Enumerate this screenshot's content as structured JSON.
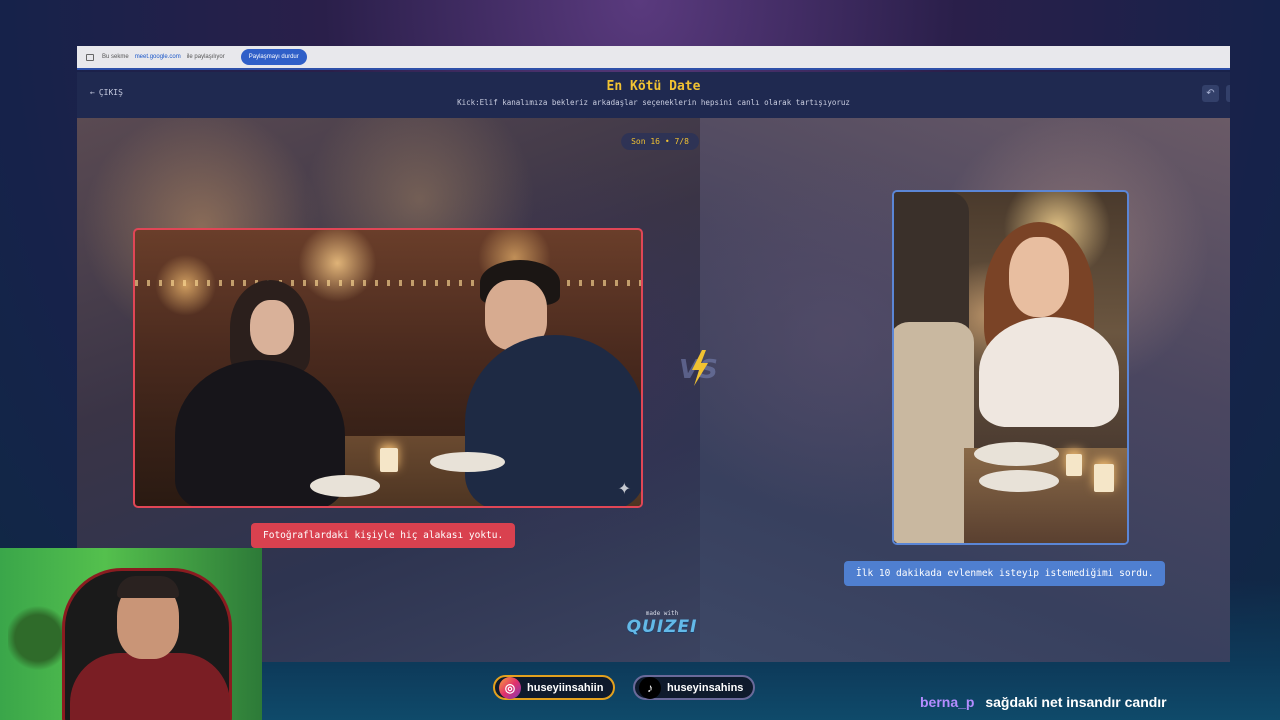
{
  "share_bar": {
    "sharing_text": "Bu sekme",
    "url": "meet.google.com",
    "sharing_suffix": "ile paylaşılıyor",
    "stop_button": "Paylaşmayı durdur"
  },
  "quiz": {
    "back_label": "ÇIKIŞ",
    "title": "En Kötü Date",
    "subtitle": "Kick:Elif kanalımıza bekleriz arkadaşlar seçeneklerin hepsini canlı olarak tartışıyoruz",
    "round_badge": "Son 16 • 7/8",
    "left_option": {
      "caption": "Fotoğraflardaki kişiyle hiç alakası yoktu.",
      "border_color": "#e04656"
    },
    "right_option": {
      "caption": "İlk 10 dakikada evlenmek isteyip istemediğimi sordu.",
      "border_color": "#5b86d6"
    },
    "vs_label": "VS",
    "made_with": "made with",
    "brand": "QUIZEI"
  },
  "socials": {
    "instagram": "huseyiinsahiin",
    "tiktok": "huseyinsahins"
  },
  "chat": {
    "username": "berna_p",
    "message": "sağdaki net insandır candır"
  }
}
